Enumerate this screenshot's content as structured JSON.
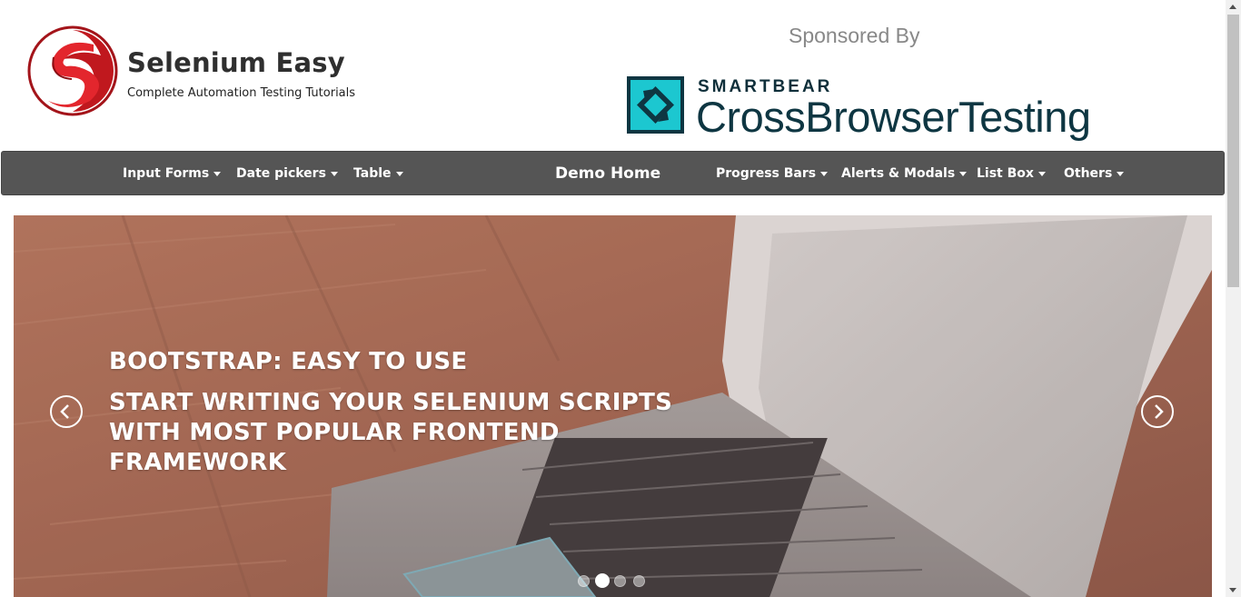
{
  "brand": {
    "title": "Selenium Easy",
    "subtitle": "Complete Automation Testing Tutorials"
  },
  "sponsor": {
    "label": "Sponsored By",
    "company": "SMARTBEAR",
    "product": "CrossBrowserTesting"
  },
  "nav": {
    "items": [
      {
        "label": "Input Forms",
        "dropdown": true
      },
      {
        "label": "Date pickers",
        "dropdown": true
      },
      {
        "label": "Table",
        "dropdown": true
      },
      {
        "label": "Demo Home",
        "dropdown": false
      },
      {
        "label": "Progress Bars",
        "dropdown": true
      },
      {
        "label": "Alerts & Modals",
        "dropdown": true
      },
      {
        "label": "List Box",
        "dropdown": true
      },
      {
        "label": "Others",
        "dropdown": true
      }
    ]
  },
  "carousel": {
    "heading": "BOOTSTRAP: EASY TO USE",
    "lines": [
      "START WRITING YOUR SELENIUM SCRIPTS",
      "WITH MOST POPULAR FRONTEND",
      "FRAMEWORK"
    ],
    "active_slide": 2,
    "slide_count": 4
  },
  "colors": {
    "navbar": "#555555",
    "brand_red": "#c0181e",
    "sponsor_teal": "#1cc7d0",
    "sponsor_dark": "#0e3642"
  }
}
